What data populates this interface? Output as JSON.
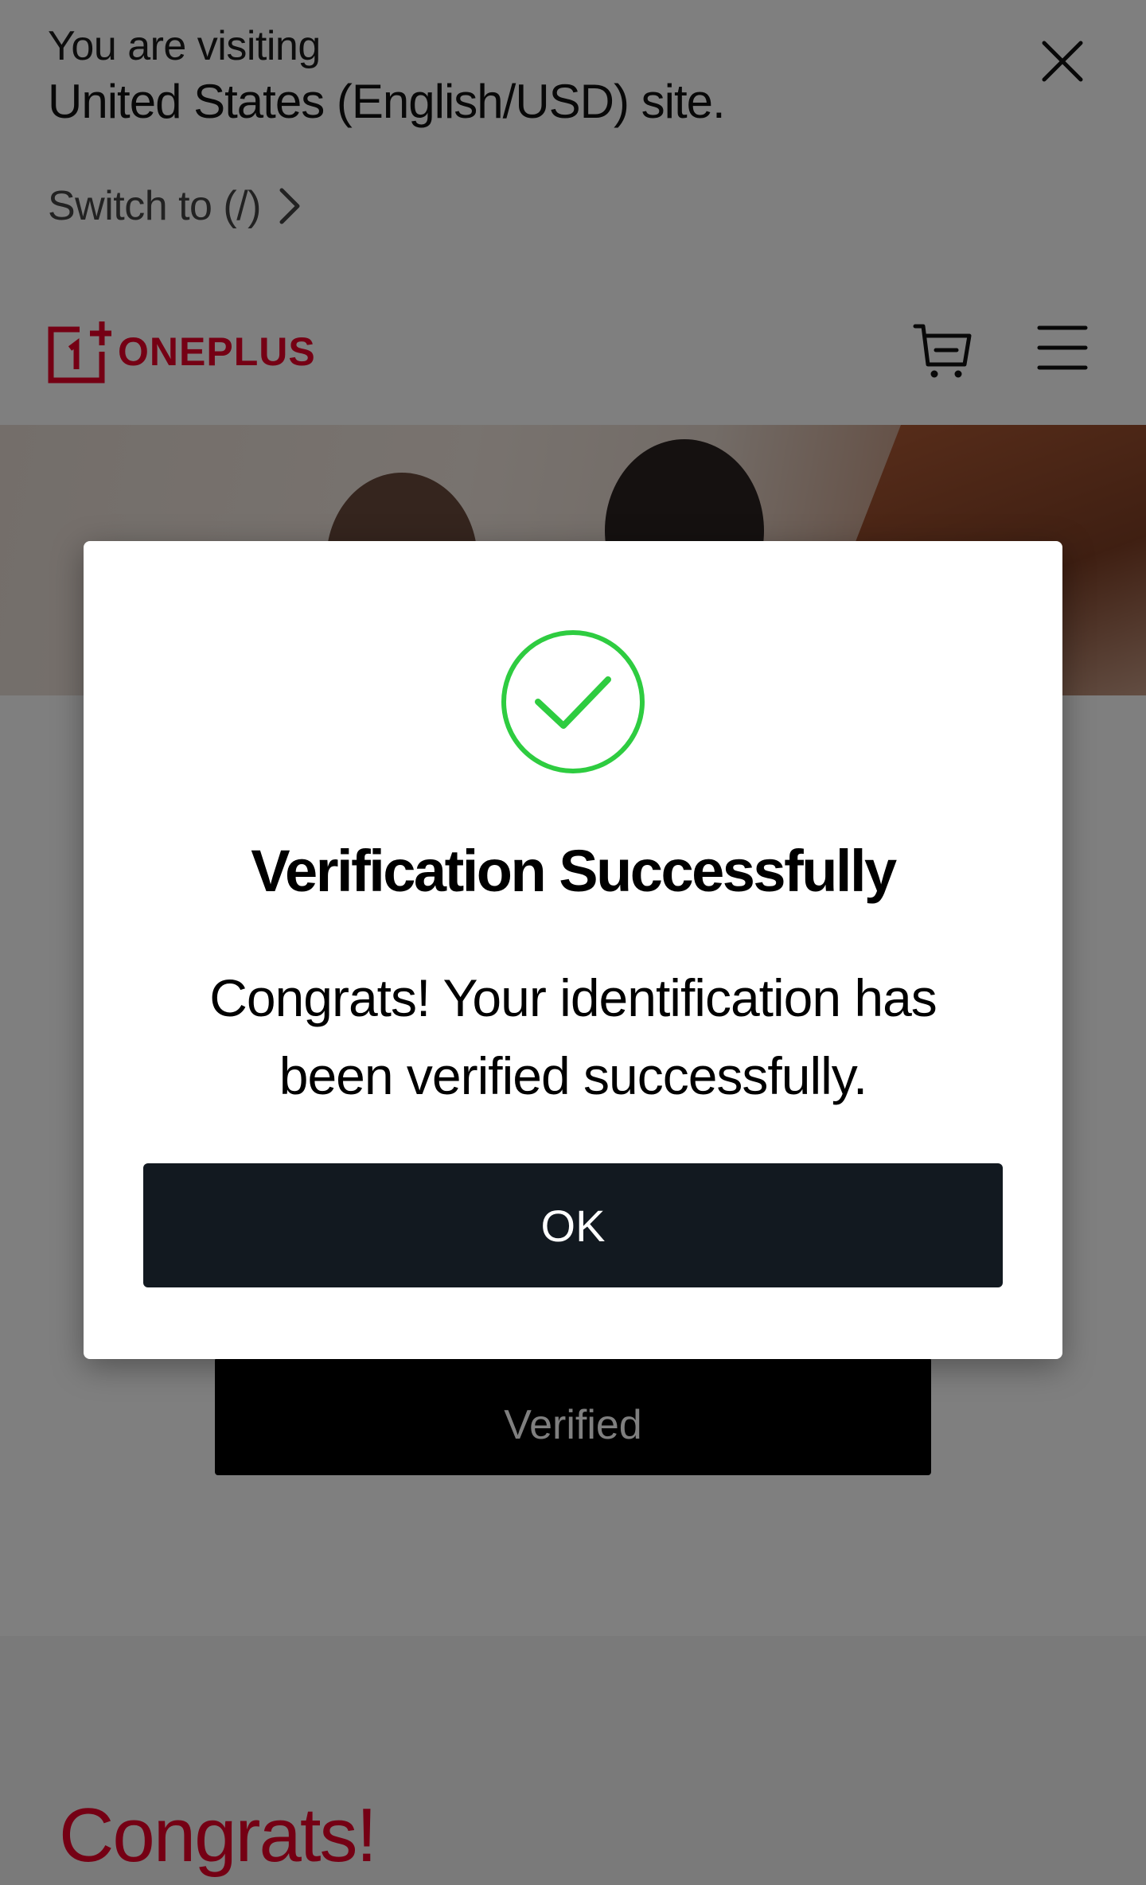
{
  "region_banner": {
    "visiting_text": "You are visiting",
    "site_text": "United States (English/USD) site.",
    "switch_label": "Switch to (/)",
    "close_icon": "close-icon",
    "chevron_icon": "chevron-right-icon"
  },
  "header": {
    "logo_text": "ONEPLUS",
    "brand_color": "#eb0028",
    "cart_icon": "cart-icon",
    "menu_icon": "hamburger-menu-icon"
  },
  "page": {
    "verified_button_label": "Verified",
    "congrats_heading": "Congrats!"
  },
  "modal": {
    "icon": "check-circle-icon",
    "icon_color": "#2ecc40",
    "title": "Verification Successfully",
    "message": "Congrats! Your identification has been verified successfully.",
    "ok_label": "OK",
    "ok_button_color": "#121920"
  }
}
